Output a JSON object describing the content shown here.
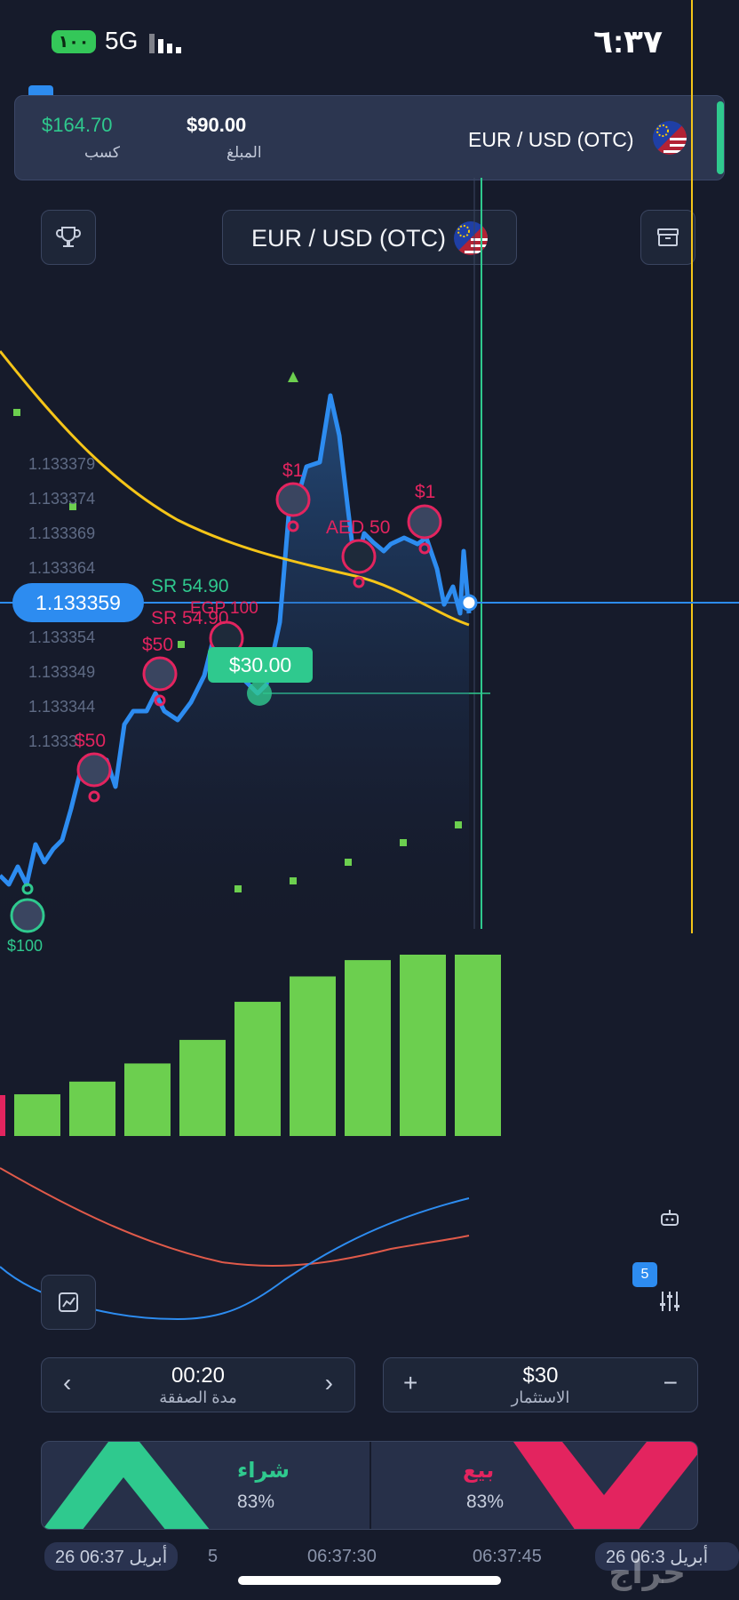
{
  "status_bar": {
    "battery": "١٠٠",
    "network": "5G",
    "time": "٦:٣٧"
  },
  "trade_card": {
    "profit_value": "$164.70",
    "profit_label": "كسب",
    "amount_value": "$90.00",
    "amount_label": "المبلغ",
    "pair": "EUR / USD (OTC)"
  },
  "header": {
    "pair_selector": "EUR / USD (OTC)",
    "left_icon": "trophy-icon",
    "right_icon": "briefcase-icon"
  },
  "chart": {
    "current_price": "1.133359",
    "y_ticks": [
      "1.133379",
      "1.133374",
      "1.133369",
      "1.133364",
      "1.133354",
      "1.133349",
      "1.133344",
      "1.1333"
    ],
    "open_trade_label": "$30.00",
    "annotations": {
      "sr_green": "SR 54.90",
      "sr_pink": "SR 54.90",
      "egp": "EGP 100",
      "aed": "AED 50",
      "d1_a": "$1",
      "d1_b": "$1",
      "d50_a": "$50",
      "d50_b": "$50",
      "d100": "$100"
    },
    "colors": {
      "price_line": "#2d8cf0",
      "moving_average": "#f5c518",
      "up_marker": "#2fc98e",
      "down_marker": "#e3245f",
      "volume_bar": "#6ccf4f"
    }
  },
  "volume_bars": [
    0.23,
    0.3,
    0.4,
    0.53,
    0.74,
    0.88,
    0.97,
    1.0,
    1.0
  ],
  "indicator_badge": "5",
  "controls": {
    "duration_value": "00:20",
    "duration_label": "مدة الصفقة",
    "investment_value": "$30",
    "investment_label": "الاستثمار",
    "prev_icon": "chevron-left-icon",
    "next_icon": "chevron-right-icon",
    "plus_icon": "plus-icon",
    "minus_icon": "minus-icon"
  },
  "trade_buttons": {
    "buy_label": "شراء",
    "buy_pct": "83%",
    "sell_label": "بيع",
    "sell_pct": "83%"
  },
  "time_axis": {
    "date_left": "26 أبريل 06:37",
    "t1": "5",
    "t2": "06:37:30",
    "t3": "06:37:45",
    "date_right": "26 أبريل 06:3"
  },
  "watermark": "حراج"
}
